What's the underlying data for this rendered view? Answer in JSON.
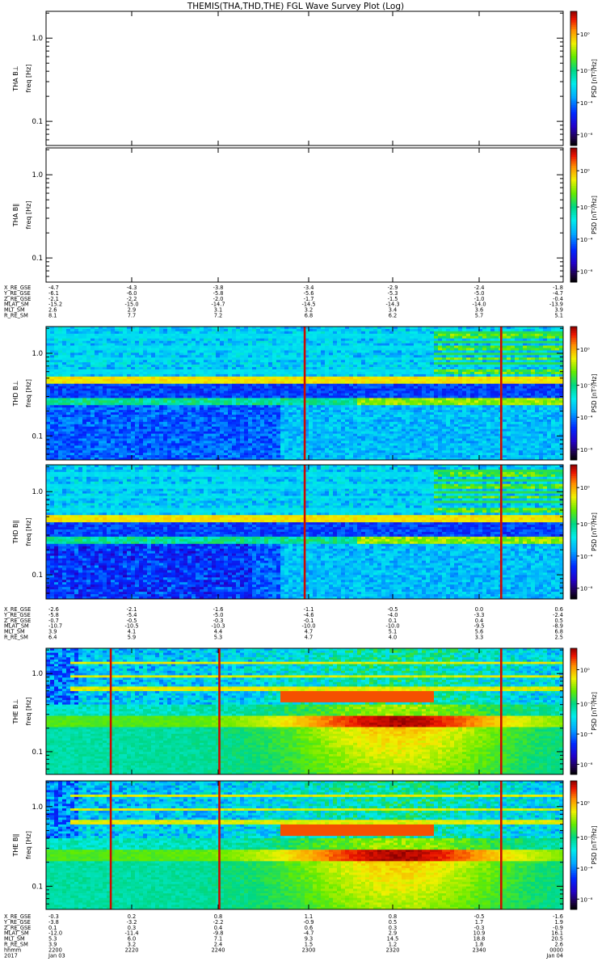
{
  "title": "THEMIS(THA,THD,THE) FGL Wave Survey Plot (Log)",
  "chart_data": {
    "type": "heatmap",
    "title": "THEMIS(THA,THD,THE) FGL Wave Survey Plot (Log)",
    "x_axis": {
      "ticks": [
        "2200",
        "2220",
        "2240",
        "2300",
        "2320",
        "2340",
        "0000"
      ],
      "date_labels": [
        "Jan 03",
        "",
        "",
        "",
        "",
        "",
        "Jan 04"
      ],
      "year_label": "2017",
      "row_label": "hhmm"
    },
    "freq_ticks": [
      "1.0",
      "0.1"
    ],
    "psd_ticks": [
      "10⁰",
      "10⁻²",
      "10⁻⁴",
      "10⁻⁶"
    ],
    "colorbar_label": "PSD [nT²/Hz]",
    "panels": [
      {
        "probe": "THA",
        "label": "THA B⊥",
        "ylabel": "freq [Hz]",
        "has_data": false
      },
      {
        "probe": "THA",
        "label": "THA B∥",
        "ylabel": "freq [Hz]",
        "has_data": false
      },
      {
        "probe": "THD",
        "label": "THD B⊥",
        "ylabel": "freq [Hz]",
        "has_data": true,
        "style": "thd",
        "lines": [
          0.5,
          0.88
        ]
      },
      {
        "probe": "THD",
        "label": "THD B∥",
        "ylabel": "freq [Hz]",
        "has_data": true,
        "style": "thd",
        "lines": [
          0.5,
          0.88
        ]
      },
      {
        "probe": "THE",
        "label": "THE B⊥",
        "ylabel": "freq [Hz]",
        "has_data": true,
        "style": "the",
        "lines": [
          0.125,
          0.335,
          0.88
        ]
      },
      {
        "probe": "THE",
        "label": "THE B∥",
        "ylabel": "freq [Hz]",
        "has_data": true,
        "style": "the",
        "lines": [
          0.125,
          0.335,
          0.88
        ]
      }
    ],
    "ephemeris": [
      {
        "probe": "THA",
        "rows": [
          {
            "label": "X_RE_GSE",
            "values": [
              "-4.7",
              "-4.3",
              "-3.8",
              "-3.4",
              "-2.9",
              "-2.4",
              "-1.8"
            ]
          },
          {
            "label": "Y_RE_GSE",
            "values": [
              "-6.1",
              "-6.0",
              "-5.8",
              "-5.6",
              "-5.3",
              "-5.0",
              "-4.7"
            ]
          },
          {
            "label": "Z_RE_GSE",
            "values": [
              "-2.1",
              "-2.2",
              "-2.0",
              "-1.7",
              "-1.5",
              "-1.0",
              "-0.4"
            ]
          },
          {
            "label": "MLAT_SM",
            "values": [
              "-15.2",
              "-15.0",
              "-14.7",
              "-14.5",
              "-14.3",
              "-14.0",
              "-13.9"
            ]
          },
          {
            "label": "MLT_SM",
            "values": [
              "2.6",
              "2.9",
              "3.1",
              "3.2",
              "3.4",
              "3.6",
              "3.9"
            ]
          },
          {
            "label": "R_RE_SM",
            "values": [
              "8.1",
              "7.7",
              "7.2",
              "6.8",
              "6.2",
              "5.7",
              "5.1"
            ]
          }
        ]
      },
      {
        "probe": "THD",
        "rows": [
          {
            "label": "X_RE_GSE",
            "values": [
              "-2.6",
              "-2.1",
              "-1.6",
              "-1.1",
              "-0.5",
              "0.0",
              "0.6"
            ]
          },
          {
            "label": "Y_RE_GSE",
            "values": [
              "-5.8",
              "-5.4",
              "-5.0",
              "-4.6",
              "-4.0",
              "-3.3",
              "-2.4"
            ]
          },
          {
            "label": "Z_RE_GSE",
            "values": [
              "-0.7",
              "-0.5",
              "-0.3",
              "-0.1",
              "0.1",
              "0.4",
              "0.5"
            ]
          },
          {
            "label": "MLAT_SM",
            "values": [
              "-10.7",
              "-10.5",
              "-10.3",
              "-10.0",
              "-10.0",
              "-9.5",
              "-8.9"
            ]
          },
          {
            "label": "MLT_SM",
            "values": [
              "3.9",
              "4.1",
              "4.4",
              "4.7",
              "5.1",
              "5.6",
              "6.8"
            ]
          },
          {
            "label": "R_RE_SM",
            "values": [
              "6.4",
              "5.9",
              "5.3",
              "4.7",
              "4.0",
              "3.3",
              "2.5"
            ]
          }
        ]
      },
      {
        "probe": "THE",
        "rows": [
          {
            "label": "X_RE_GSE",
            "values": [
              "-0.3",
              "0.2",
              "0.8",
              "1.1",
              "0.8",
              "-0.5",
              "-1.6"
            ]
          },
          {
            "label": "Y_RE_GSE",
            "values": [
              "-3.8",
              "-3.2",
              "-2.2",
              "-0.9",
              "0.5",
              "1.7",
              "1.9"
            ]
          },
          {
            "label": "Z_RE_GSE",
            "values": [
              "0.1",
              "0.3",
              "0.4",
              "0.6",
              "0.3",
              "-0.3",
              "-0.9"
            ]
          },
          {
            "label": "MLAT_SM",
            "values": [
              "-12.0",
              "-11.4",
              "-9.8",
              "-4.7",
              "2.9",
              "10.9",
              "16.1"
            ]
          },
          {
            "label": "MLT_SM",
            "values": [
              "5.3",
              "6.0",
              "7.1",
              "9.3",
              "14.5",
              "18.8",
              "20.5"
            ]
          },
          {
            "label": "R_RE_SM",
            "values": [
              "3.9",
              "3.2",
              "2.4",
              "1.5",
              "1.2",
              "1.8",
              "2.6"
            ]
          }
        ]
      }
    ]
  }
}
